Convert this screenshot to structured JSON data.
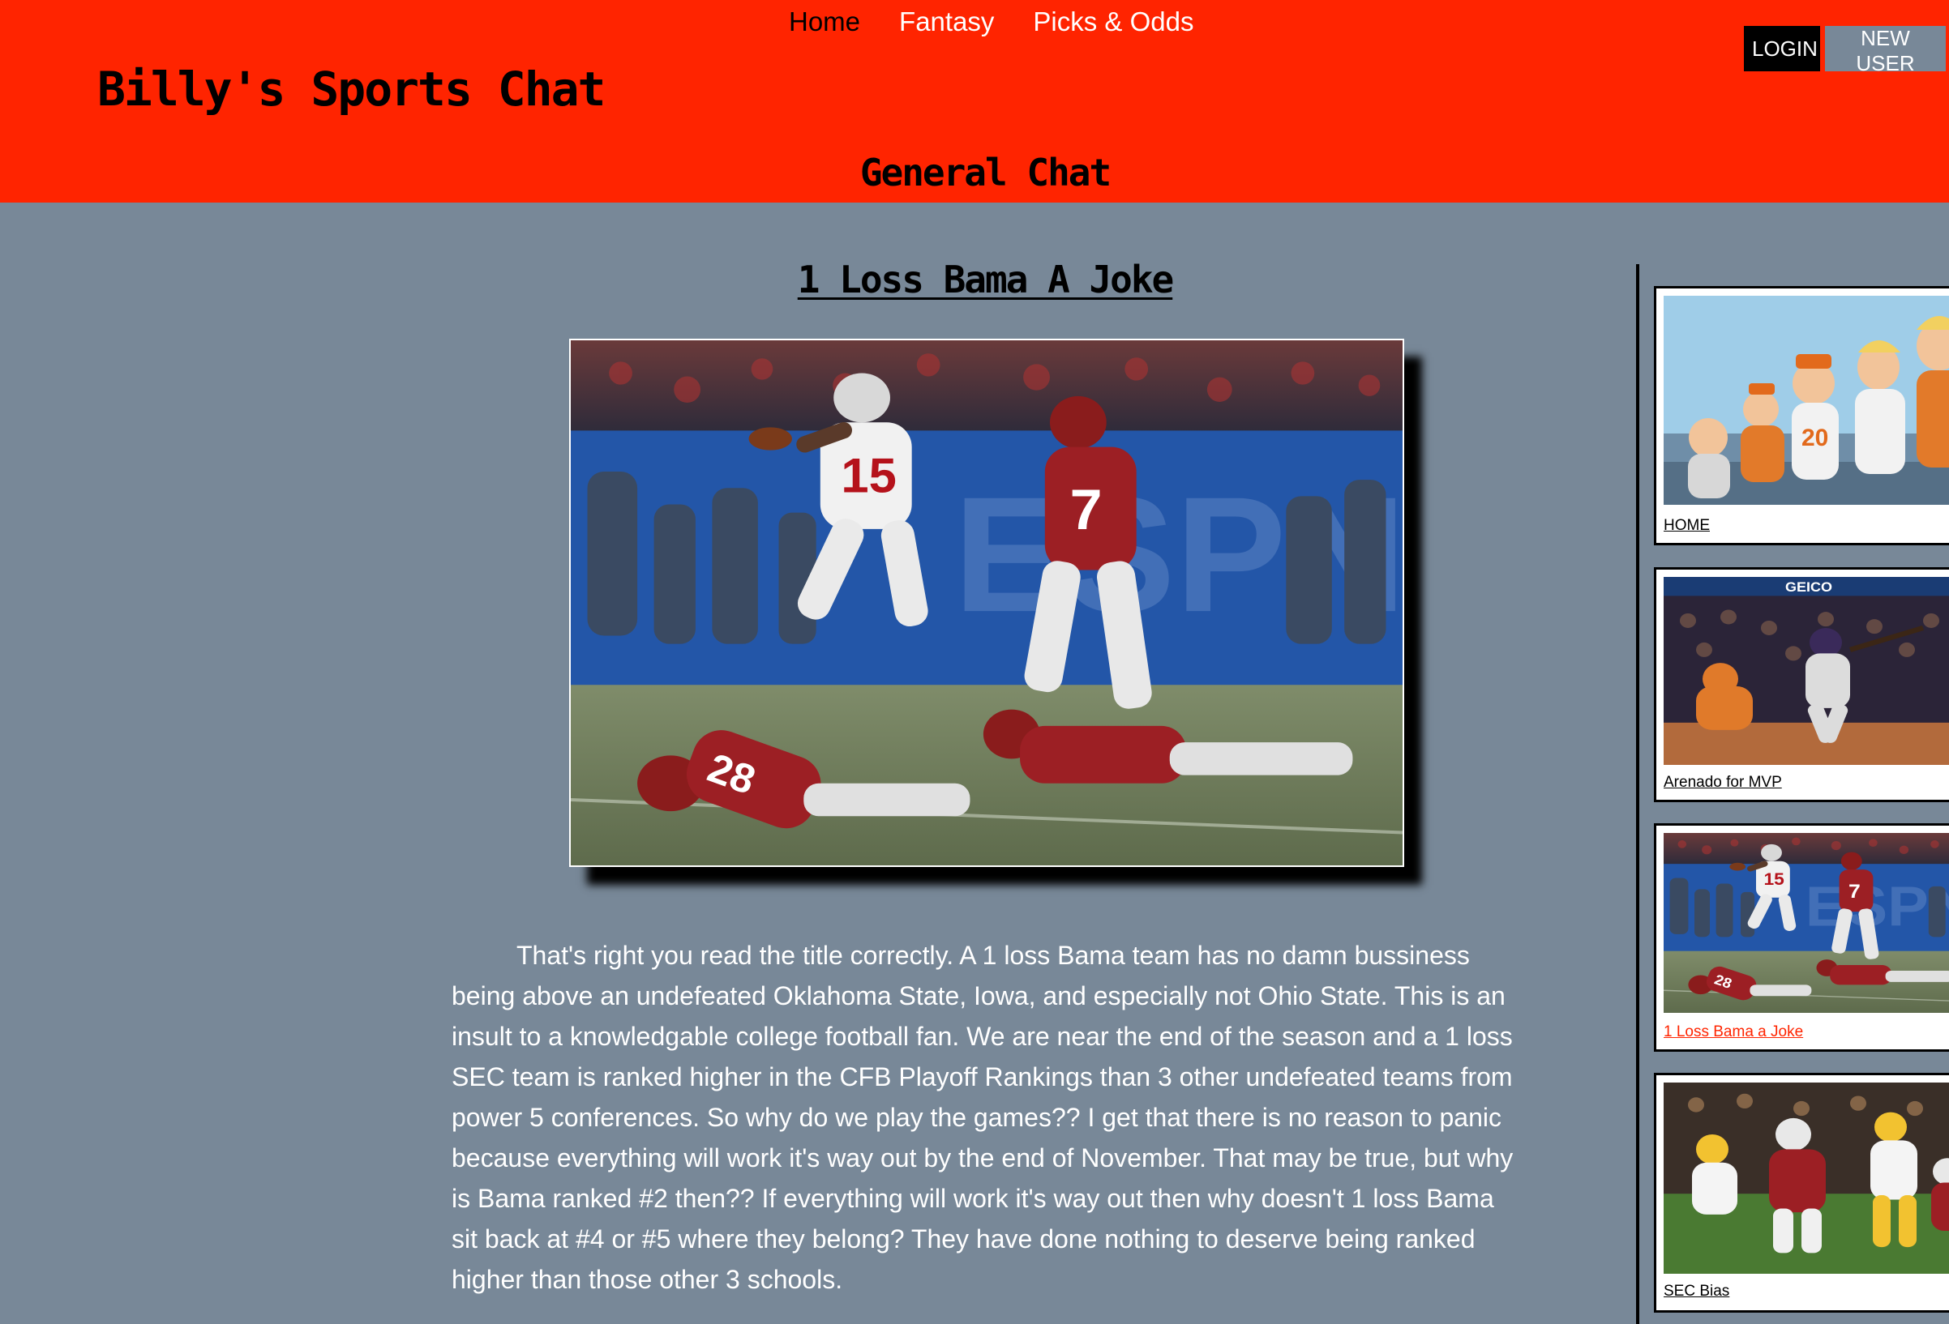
{
  "header": {
    "nav": [
      "Home",
      "Fantasy",
      "Picks & Odds"
    ],
    "site_title": "Billy's Sports Chat",
    "section_title": "General Chat",
    "login_label": "LOGIN",
    "new_user_label": "NEW USER"
  },
  "article": {
    "title": "1 Loss Bama A Joke",
    "body": "That's right you read the title correctly. A 1 loss Bama team has no damn bussiness being above an undefeated Oklahoma State, Iowa, and especially not Ohio State. This is an insult to a knowledgable college football fan. We are near the end of the season and a 1 loss SEC team is ranked higher in the CFB Playoff Rankings than 3 other undefeated teams from power 5 conferences. So why do we play the games?? I get that there is no reason to panic because everything will work it's way out by the end of November. That may be true, but why is Bama ranked #2 then?? If everything will work it's way out then why doesn't 1 loss Bama sit back at #4 or #5 where they belong? They have done nothing to deserve being ranked higher than those other 3 schools."
  },
  "sidebar": {
    "items": [
      {
        "caption": "HOME"
      },
      {
        "caption": "Arenado for MVP"
      },
      {
        "caption": "1 Loss Bama a Joke"
      },
      {
        "caption": "SEC Bias"
      }
    ]
  },
  "colors": {
    "header_bg": "#ff2400",
    "page_bg": "#788898",
    "active_link": "#ff2400"
  }
}
